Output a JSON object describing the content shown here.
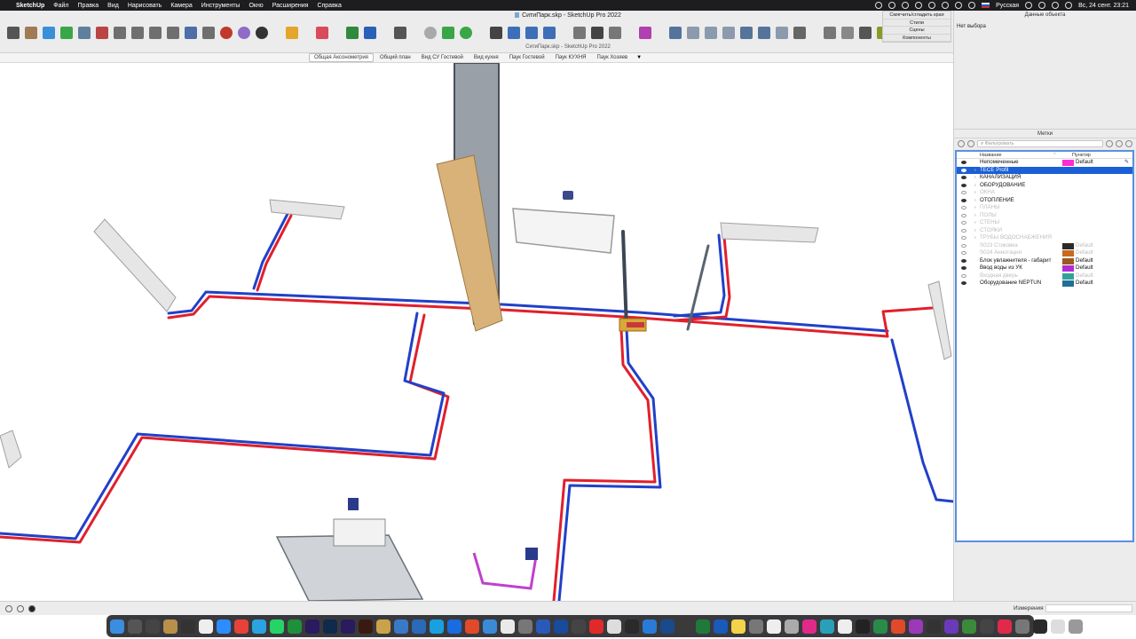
{
  "menubar": {
    "app_name": "SketchUp",
    "items": [
      "Файл",
      "Правка",
      "Вид",
      "Нарисовать",
      "Камера",
      "Инструменты",
      "Окно",
      "Расширения",
      "Справка"
    ],
    "input_source": "Русская",
    "datetime": "Вс, 24 сент.  23:21"
  },
  "window": {
    "title": "СитиПарк.skp - SketchUp Pro 2022",
    "subtitle": "СитиПарк.skp - SketchUp Pro 2022"
  },
  "scenes": {
    "tabs": [
      "Общая Аксонометрия",
      "Общий план",
      "Вид СУ Гостевой",
      "Вид кухня",
      "Паук Гостевой",
      "Паук КУХНЯ",
      "Паук Хозяев"
    ],
    "active_index": 0,
    "more": "▼"
  },
  "tray": {
    "items": [
      "Смягчить/сгладить края",
      "Стили",
      "Сцены",
      "Компоненты"
    ]
  },
  "entity_info": {
    "title": "Данные объекта",
    "status": "Нет выбора"
  },
  "tags_panel": {
    "title": "Метки",
    "filter_placeholder": "Фильтровать",
    "col_name": "Название",
    "col_sort": "⌃",
    "col_dash": "Пунктир",
    "rows": [
      {
        "name": "Непомеченные",
        "visible": true,
        "expand": false,
        "selected": false,
        "dim": false,
        "color": "#ff2bd6",
        "dash": "Default",
        "pencil": "✎"
      },
      {
        "name": "TECE Profil",
        "visible": true,
        "expand": true,
        "selected": true,
        "dim": false,
        "color": "",
        "dash": "",
        "pencil": ""
      },
      {
        "name": "КАНАЛИЗАЦИЯ",
        "visible": true,
        "expand": true,
        "selected": false,
        "dim": false,
        "color": "",
        "dash": "",
        "pencil": ""
      },
      {
        "name": "ОБОРУДОВАНИЕ",
        "visible": true,
        "expand": true,
        "selected": false,
        "dim": false,
        "color": "",
        "dash": "",
        "pencil": ""
      },
      {
        "name": "ОКНА",
        "visible": false,
        "expand": true,
        "selected": false,
        "dim": true,
        "color": "",
        "dash": "",
        "pencil": ""
      },
      {
        "name": "ОТОПЛЕНИЕ",
        "visible": true,
        "expand": true,
        "selected": false,
        "dim": false,
        "color": "",
        "dash": "",
        "pencil": ""
      },
      {
        "name": "ПЛАНЫ",
        "visible": false,
        "expand": true,
        "selected": false,
        "dim": true,
        "color": "",
        "dash": "",
        "pencil": ""
      },
      {
        "name": "ПОЛЫ",
        "visible": false,
        "expand": true,
        "selected": false,
        "dim": true,
        "color": "",
        "dash": "",
        "pencil": ""
      },
      {
        "name": "СТЕНЫ",
        "visible": false,
        "expand": true,
        "selected": false,
        "dim": true,
        "color": "",
        "dash": "",
        "pencil": ""
      },
      {
        "name": "СТОЯКИ",
        "visible": false,
        "expand": true,
        "selected": false,
        "dim": true,
        "color": "",
        "dash": "",
        "pencil": ""
      },
      {
        "name": "ТРУБЫ ВОДОСНАБЖЕНИЯ",
        "visible": false,
        "expand": true,
        "selected": false,
        "dim": true,
        "color": "",
        "dash": "",
        "pencil": ""
      },
      {
        "name": "S023 Стиковка",
        "visible": false,
        "expand": false,
        "selected": false,
        "dim": true,
        "color": "#2b2b2b",
        "dash": "Default",
        "pencil": ""
      },
      {
        "name": "S024 Аннотация",
        "visible": false,
        "expand": false,
        "selected": false,
        "dim": true,
        "color": "#c8691e",
        "dash": "Default",
        "pencil": ""
      },
      {
        "name": "Блок увлажнителя - габарит",
        "visible": true,
        "expand": false,
        "selected": false,
        "dim": false,
        "color": "#9a5a1e",
        "dash": "Default",
        "pencil": ""
      },
      {
        "name": "Ввод воды из УК",
        "visible": true,
        "expand": false,
        "selected": false,
        "dim": false,
        "color": "#b42bd6",
        "dash": "Default",
        "pencil": ""
      },
      {
        "name": "Входная дверь",
        "visible": false,
        "expand": false,
        "selected": false,
        "dim": true,
        "color": "#2fa39a",
        "dash": "Default",
        "pencil": ""
      },
      {
        "name": "Оборудование NEPTUN",
        "visible": true,
        "expand": false,
        "selected": false,
        "dim": false,
        "color": "#1f6f96",
        "dash": "Default",
        "pencil": ""
      }
    ]
  },
  "statusbar": {
    "measure_label": "Измерения"
  },
  "colors": {
    "pipe_hot": "#e0202c",
    "pipe_cold": "#2140c8",
    "selection": "#1a5fd6",
    "panel_border": "#5a8fe0"
  }
}
